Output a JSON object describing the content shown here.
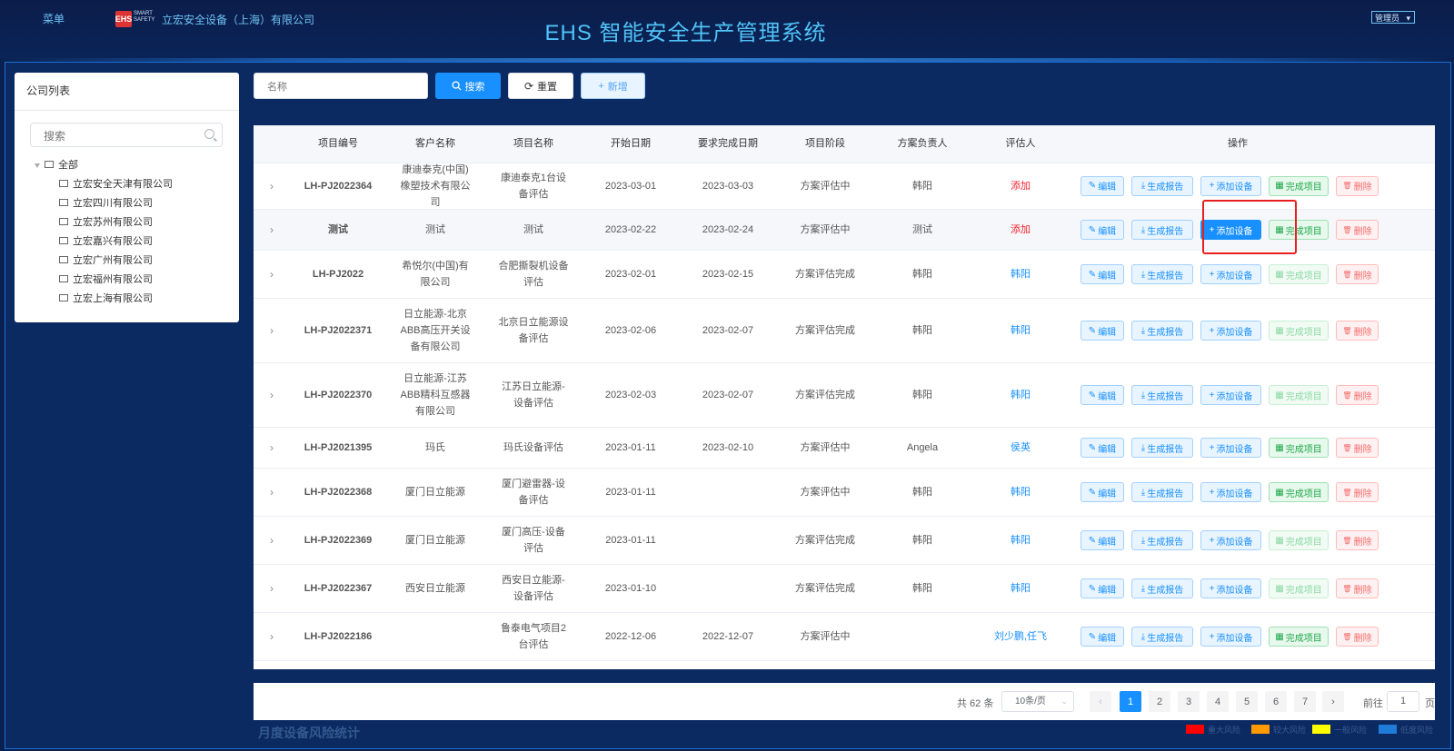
{
  "header": {
    "menu_label": "菜单",
    "logo_badge": "EHS",
    "logo_small": "SMART SAFETY",
    "company": "立宏安全设备（上海）有限公司",
    "title": "EHS 智能安全生产管理系统",
    "user_menu": "管理员"
  },
  "left_panel": {
    "title": "公司列表",
    "search_placeholder": "搜索",
    "root": "全部",
    "companies": [
      "立宏安全天津有限公司",
      "立宏四川有限公司",
      "立宏苏州有限公司",
      "立宏嘉兴有限公司",
      "立宏广州有限公司",
      "立宏福州有限公司",
      "立宏上海有限公司"
    ]
  },
  "toolbar": {
    "name_placeholder": "名称",
    "search_label": "搜索",
    "reset_label": "重置",
    "add_label": "新增"
  },
  "table": {
    "columns": [
      "项目编号",
      "客户名称",
      "项目名称",
      "开始日期",
      "要求完成日期",
      "项目阶段",
      "方案负责人",
      "评估人",
      "操作"
    ],
    "actions": {
      "edit": "编辑",
      "report": "生成报告",
      "add_device": "添加设备",
      "complete": "完成项目",
      "delete": "删除"
    },
    "rows": [
      {
        "code": "LH-PJ2022364",
        "customer": "康迪泰克(中国)橡塑技术有限公司",
        "project": "康迪泰克1台设备评估",
        "start": "2023-03-01",
        "due": "2023-03-03",
        "stage": "方案评估中",
        "owner": "韩阳",
        "assessor": "添加",
        "assessor_red": true,
        "done_enabled": true,
        "highlight": false,
        "add_active": false
      },
      {
        "code": "测试",
        "customer": "测试",
        "project": "测试",
        "start": "2023-02-22",
        "due": "2023-02-24",
        "stage": "方案评估中",
        "owner": "测试",
        "assessor": "添加",
        "assessor_red": true,
        "done_enabled": true,
        "highlight": true,
        "add_active": true
      },
      {
        "code": "LH-PJ2022",
        "customer": "希悦尔(中国)有限公司",
        "project": "合肥撕裂机设备评估",
        "start": "2023-02-01",
        "due": "2023-02-15",
        "stage": "方案评估完成",
        "owner": "韩阳",
        "assessor": "韩阳",
        "assessor_red": false,
        "done_enabled": false,
        "highlight": false,
        "add_active": false
      },
      {
        "code": "LH-PJ2022371",
        "customer": "日立能源-北京ABB高压开关设备有限公司",
        "project": "北京日立能源设备评估",
        "start": "2023-02-06",
        "due": "2023-02-07",
        "stage": "方案评估完成",
        "owner": "韩阳",
        "assessor": "韩阳",
        "assessor_red": false,
        "done_enabled": false,
        "highlight": false,
        "add_active": false
      },
      {
        "code": "LH-PJ2022370",
        "customer": "日立能源-江苏ABB精科互感器有限公司",
        "project": "江苏日立能源-设备评估",
        "start": "2023-02-03",
        "due": "2023-02-07",
        "stage": "方案评估完成",
        "owner": "韩阳",
        "assessor": "韩阳",
        "assessor_red": false,
        "done_enabled": false,
        "highlight": false,
        "add_active": false
      },
      {
        "code": "LH-PJ2021395",
        "customer": "玛氏",
        "project": "玛氏设备评估",
        "start": "2023-01-11",
        "due": "2023-02-10",
        "stage": "方案评估中",
        "owner": "Angela",
        "assessor": "侯英",
        "assessor_red": false,
        "done_enabled": true,
        "highlight": false,
        "add_active": false
      },
      {
        "code": "LH-PJ2022368",
        "customer": "厦门日立能源",
        "project": "厦门避雷器-设备评估",
        "start": "2023-01-11",
        "due": "",
        "stage": "方案评估中",
        "owner": "韩阳",
        "assessor": "韩阳",
        "assessor_red": false,
        "done_enabled": true,
        "highlight": false,
        "add_active": false
      },
      {
        "code": "LH-PJ2022369",
        "customer": "厦门日立能源",
        "project": "厦门高压-设备评估",
        "start": "2023-01-11",
        "due": "",
        "stage": "方案评估完成",
        "owner": "韩阳",
        "assessor": "韩阳",
        "assessor_red": false,
        "done_enabled": false,
        "highlight": false,
        "add_active": false
      },
      {
        "code": "LH-PJ2022367",
        "customer": "西安日立能源",
        "project": "西安日立能源-设备评估",
        "start": "2023-01-10",
        "due": "",
        "stage": "方案评估完成",
        "owner": "韩阳",
        "assessor": "韩阳",
        "assessor_red": false,
        "done_enabled": false,
        "highlight": false,
        "add_active": false
      },
      {
        "code": "LH-PJ2022186",
        "customer": "",
        "project": "鲁泰电气项目2台评估",
        "start": "2022-12-06",
        "due": "2022-12-07",
        "stage": "方案评估中",
        "owner": "",
        "assessor": "刘少鹏,任飞",
        "assessor_red": false,
        "done_enabled": true,
        "highlight": false,
        "add_active": false
      }
    ]
  },
  "pagination": {
    "total_text": "共 62 条",
    "page_size": "10条/页",
    "pages": [
      "1",
      "2",
      "3",
      "4",
      "5",
      "6",
      "7"
    ],
    "current": "1",
    "goto_label": "前往",
    "goto_value": "1",
    "page_suffix": "页"
  },
  "bottom": {
    "section_title": "月度设备风险统计",
    "legend": [
      {
        "label": "重大风险",
        "color": "#ff0000"
      },
      {
        "label": "较大风险",
        "color": "#ff9900"
      },
      {
        "label": "一般风险",
        "color": "#ffff00"
      },
      {
        "label": "低度风险",
        "color": "#1e7bd8"
      }
    ]
  }
}
